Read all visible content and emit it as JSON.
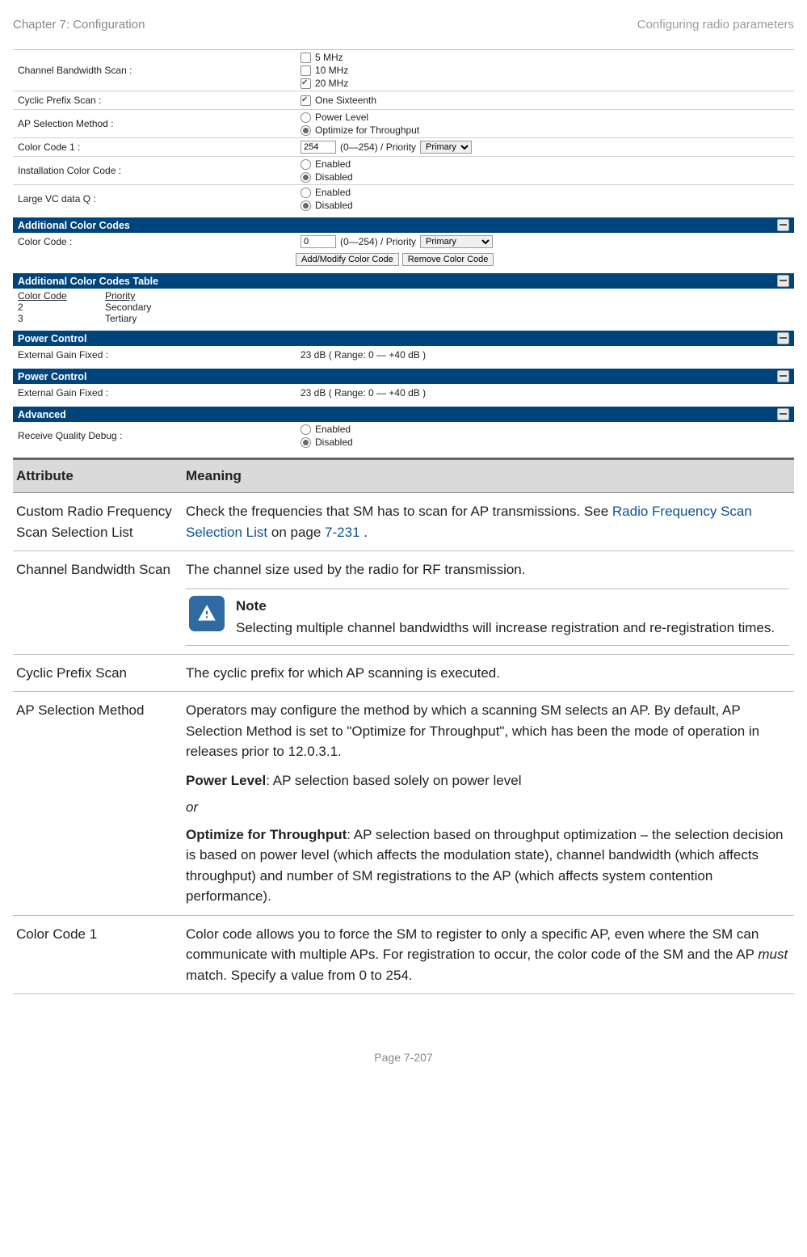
{
  "header": {
    "left": "Chapter 7:  Configuration",
    "right": "Configuring radio parameters"
  },
  "footer": "Page 7-207",
  "cfg": {
    "channel_bw": {
      "label": "Channel Bandwidth Scan :",
      "opts": [
        "5 MHz",
        "10 MHz",
        "20 MHz"
      ]
    },
    "cyclic": {
      "label": "Cyclic Prefix Scan :",
      "opt": "One Sixteenth"
    },
    "apsel": {
      "label": "AP Selection Method :",
      "opts": [
        "Power Level",
        "Optimize for Throughput"
      ]
    },
    "cc1": {
      "label": "Color Code 1 :",
      "value": "254",
      "range": "(0—254) / Priority",
      "sel": "Primary"
    },
    "icc": {
      "label": "Installation Color Code :",
      "opts": [
        "Enabled",
        "Disabled"
      ]
    },
    "lvc": {
      "label": "Large VC data Q :",
      "opts": [
        "Enabled",
        "Disabled"
      ]
    },
    "sec1": {
      "title": "Additional Color Codes",
      "cc": {
        "label": "Color Code :",
        "value": "0",
        "range": "(0—254) / Priority",
        "sel": "Primary"
      },
      "btn1": "Add/Modify Color Code",
      "btn2": "Remove Color Code"
    },
    "sec2": {
      "title": "Additional Color Codes Table",
      "head": [
        "Color Code",
        "Priority"
      ],
      "rows": [
        [
          "2",
          "Secondary"
        ],
        [
          "3",
          "Tertiary"
        ]
      ]
    },
    "pc": {
      "title": "Power Control",
      "label": "External Gain Fixed :",
      "value": "23 dB ( Range: 0 — +40 dB )"
    },
    "adv": {
      "title": "Advanced",
      "label": "Receive Quality Debug :",
      "opts": [
        "Enabled",
        "Disabled"
      ]
    }
  },
  "table": {
    "head": [
      "Attribute",
      "Meaning"
    ],
    "rows": {
      "r1": {
        "attr": "Custom Radio Frequency Scan Selection List",
        "meaning_pre": "Check the frequencies that SM has to scan for AP transmissions. See ",
        "link": "Radio Frequency Scan Selection List",
        "meaning_mid": " on page ",
        "page": "7-231",
        "meaning_post": "."
      },
      "r2": {
        "attr": "Channel Bandwidth Scan",
        "meaning": "The channel size used by the radio for RF transmission.",
        "note_title": "Note",
        "note_body": "Selecting multiple channel bandwidths will increase registration and re-registration times."
      },
      "r3": {
        "attr": "Cyclic Prefix Scan",
        "meaning": "The cyclic prefix for which AP scanning is executed."
      },
      "r4": {
        "attr": "AP Selection Method",
        "p1": "Operators may configure the method by which a scanning SM selects an AP. By default, AP Selection Method is set to \"Optimize for Throughput\", which has been the mode of operation in releases prior to 12.0.3.1.",
        "pl_label": "Power Level",
        "pl_text": ": AP selection based solely on power level",
        "or": "or",
        "ot_label": "Optimize for Throughput",
        "ot_text": ": AP selection based on throughput optimization – the selection decision is based on power level (which affects the modulation state), channel bandwidth (which affects throughput) and number of SM registrations to the AP (which affects system contention performance)."
      },
      "r5": {
        "attr": "Color Code 1",
        "p1_a": "Color code allows you to force the SM to register to only a specific AP, even where the SM can communicate with multiple APs. For registration to occur, the color code of the SM and the AP ",
        "must": "must",
        "p1_b": " match. Specify a value from 0 to 254."
      }
    }
  }
}
